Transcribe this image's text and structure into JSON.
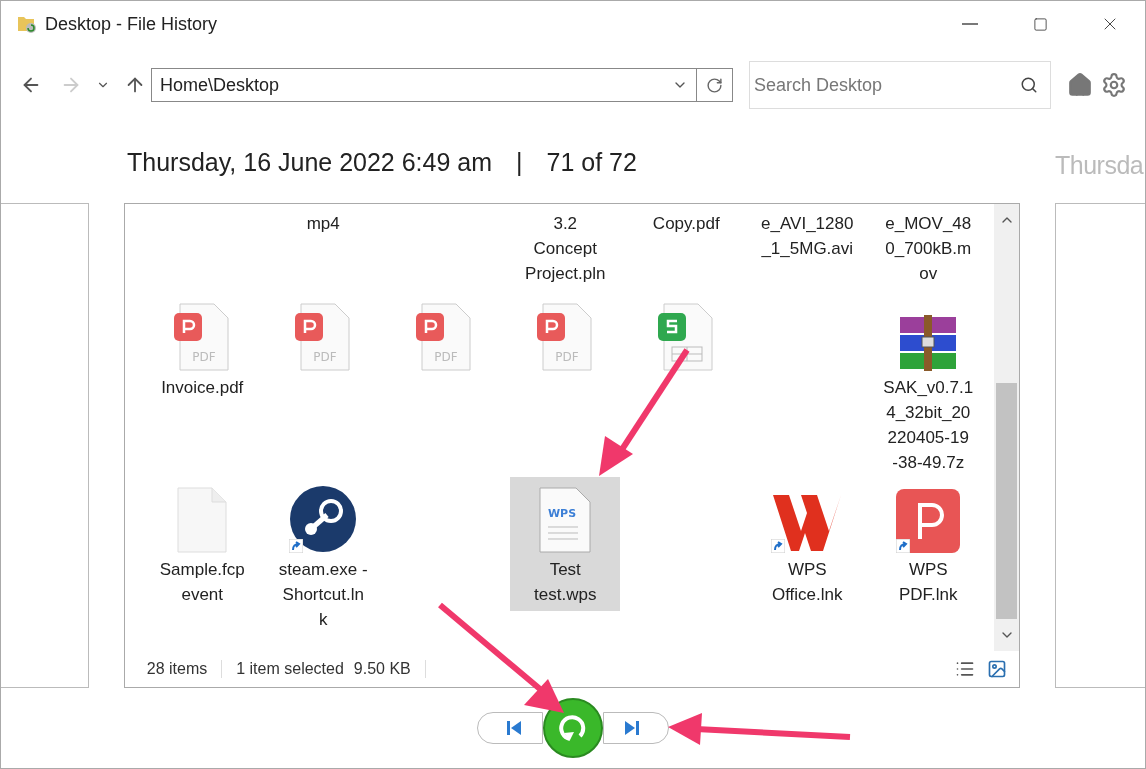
{
  "window": {
    "title": "Desktop - File History"
  },
  "address": {
    "value": "Home\\Desktop"
  },
  "search": {
    "placeholder": "Search Desktop"
  },
  "snapshot": {
    "date": "Thursday, 16 June 2022 6:49 am",
    "separator": "|",
    "position": "71 of 72",
    "next_date": "Thursda"
  },
  "rows": [
    [
      {
        "kind": "empty"
      },
      {
        "kind": "label",
        "lines": [
          "mp4"
        ],
        "selected": false
      },
      {
        "kind": "empty"
      },
      {
        "kind": "label",
        "lines": [
          "3.2",
          "Concept",
          "Project.pln"
        ],
        "selected": false
      },
      {
        "kind": "label",
        "lines": [
          "Copy.pdf"
        ],
        "selected": false
      },
      {
        "kind": "label",
        "lines": [
          "e_AVI_1280",
          "_1_5MG.avi"
        ],
        "selected": false
      },
      {
        "kind": "label",
        "lines": [
          "e_MOV_48",
          "0_700kB.m",
          "ov"
        ],
        "selected": false
      }
    ],
    [
      {
        "kind": "pdf",
        "icon_text": "PDF",
        "lines": [
          "Invoice.pdf"
        ],
        "selected": false,
        "shortcut": false
      },
      {
        "kind": "pdf",
        "icon_text": "PDF",
        "selected": false,
        "shortcut": false
      },
      {
        "kind": "pdf",
        "icon_text": "PDF",
        "selected": false,
        "shortcut": false
      },
      {
        "kind": "pdf",
        "icon_text": "PDF",
        "selected": false,
        "shortcut": false
      },
      {
        "kind": "sheet",
        "selected": false,
        "shortcut": false
      },
      {
        "kind": "empty"
      },
      {
        "kind": "archive",
        "lines": [
          "SAK_v0.7.1",
          "4_32bit_20",
          "220405-19",
          "-38-49.7z"
        ],
        "selected": false,
        "shortcut": false
      }
    ],
    [
      {
        "kind": "blank",
        "lines": [
          "Sample.fcp",
          "event"
        ],
        "selected": false,
        "shortcut": false
      },
      {
        "kind": "steam",
        "lines": [
          "steam.exe -",
          "Shortcut.ln",
          "k"
        ],
        "selected": false,
        "shortcut": true
      },
      {
        "kind": "empty"
      },
      {
        "kind": "wpsdoc",
        "icon_text": "WPS",
        "lines": [
          "Test",
          "test.wps"
        ],
        "selected": true,
        "shortcut": false
      },
      {
        "kind": "empty"
      },
      {
        "kind": "wpsoffice",
        "lines": [
          "WPS",
          "Office.lnk"
        ],
        "selected": false,
        "shortcut": true
      },
      {
        "kind": "wpspdf",
        "lines": [
          "WPS",
          "PDF.lnk"
        ],
        "selected": false,
        "shortcut": true
      }
    ]
  ],
  "status_bar": {
    "count": "28 items",
    "selection": "1 item selected",
    "size": "9.50 KB"
  }
}
